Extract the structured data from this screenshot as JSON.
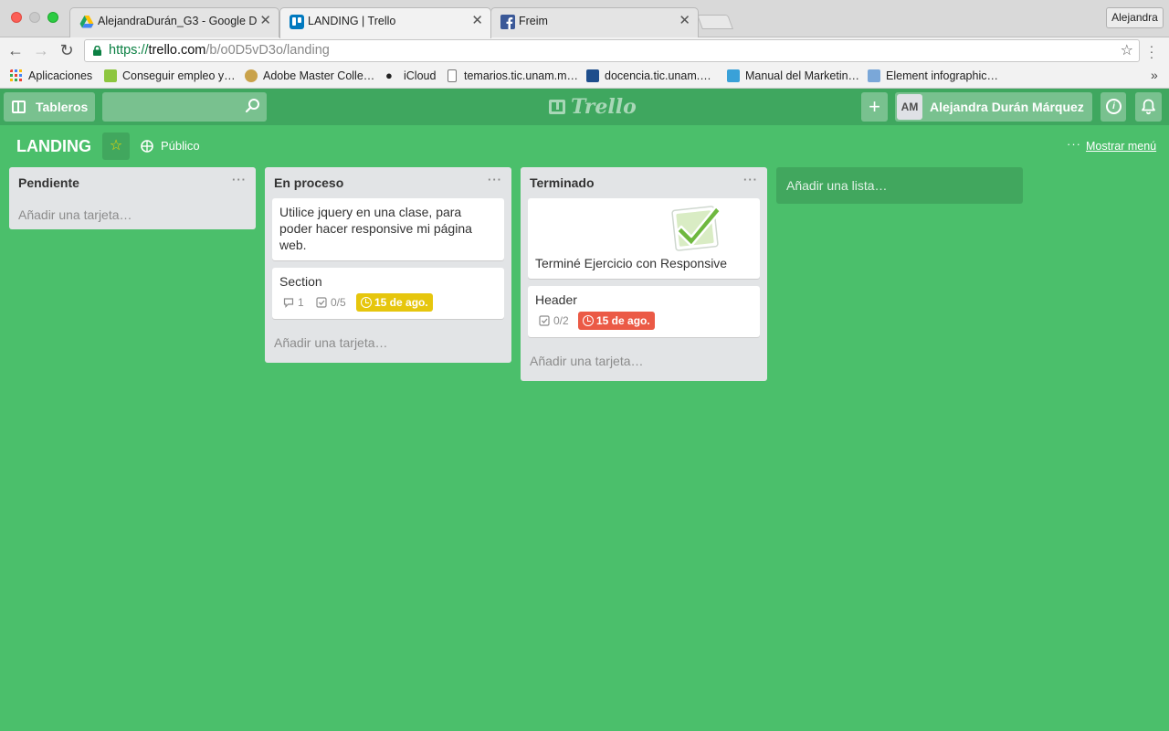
{
  "browser": {
    "tabs": [
      {
        "title": "AlejandraDurán_G3 - Google D",
        "icon": "google-drive-icon"
      },
      {
        "title": "LANDING | Trello",
        "icon": "trello-icon"
      },
      {
        "title": "Freim",
        "icon": "facebook-icon"
      }
    ],
    "profile": "Alejandra",
    "url": {
      "scheme": "https://",
      "host": "trello.com",
      "path": "/b/o0D5vD3o/landing"
    },
    "bookmarks": [
      {
        "label": "Aplicaciones",
        "icon": "apps-grid-icon"
      },
      {
        "label": "Conseguir empleo y…",
        "icon": "bookmark-site-icon"
      },
      {
        "label": "Adobe Master Colle…",
        "icon": "bookmark-site-icon"
      },
      {
        "label": "iCloud",
        "icon": "apple-icon"
      },
      {
        "label": "temarios.tic.unam.m…",
        "icon": "page-icon"
      },
      {
        "label": "docencia.tic.unam.…",
        "icon": "bookmark-site-icon"
      },
      {
        "label": "Manual del Marketin…",
        "icon": "bookmark-site-icon"
      },
      {
        "label": "Element infographic…",
        "icon": "bookmark-site-icon"
      }
    ]
  },
  "header": {
    "boards_label": "Tableros",
    "logo_text": "Trello",
    "add_label": "+",
    "member_initials": "AM",
    "member_name": "Alejandra Durán Márquez"
  },
  "board": {
    "title": "LANDING",
    "visibility": "Público",
    "show_menu": "Mostrar menú",
    "add_list": "Añadir una lista…",
    "lists": [
      {
        "name": "Pendiente",
        "add_card": "Añadir una tarjeta…",
        "cards": []
      },
      {
        "name": "En proceso",
        "add_card": "Añadir una tarjeta…",
        "cards": [
          {
            "title": "Utilice jquery en una clase, para poder hacer responsive mi página web."
          },
          {
            "title": "Section",
            "comments": "1",
            "checklist": "0/5",
            "due": "15 de ago.",
            "due_status": "soon"
          }
        ]
      },
      {
        "name": "Terminado",
        "add_card": "Añadir una tarjeta…",
        "cards": [
          {
            "title": "Terminé Ejercicio con Responsive",
            "cover": "checkmark-sticker"
          },
          {
            "title": "Header",
            "checklist": "0/2",
            "due": "15 de ago.",
            "due_status": "past"
          }
        ]
      }
    ]
  },
  "colors": {
    "board_background": "#4bbf6b",
    "header_background": "#3fa75f",
    "list_background": "#e2e4e6",
    "due_soon": "#e6c60d",
    "due_past": "#eb5a46"
  }
}
